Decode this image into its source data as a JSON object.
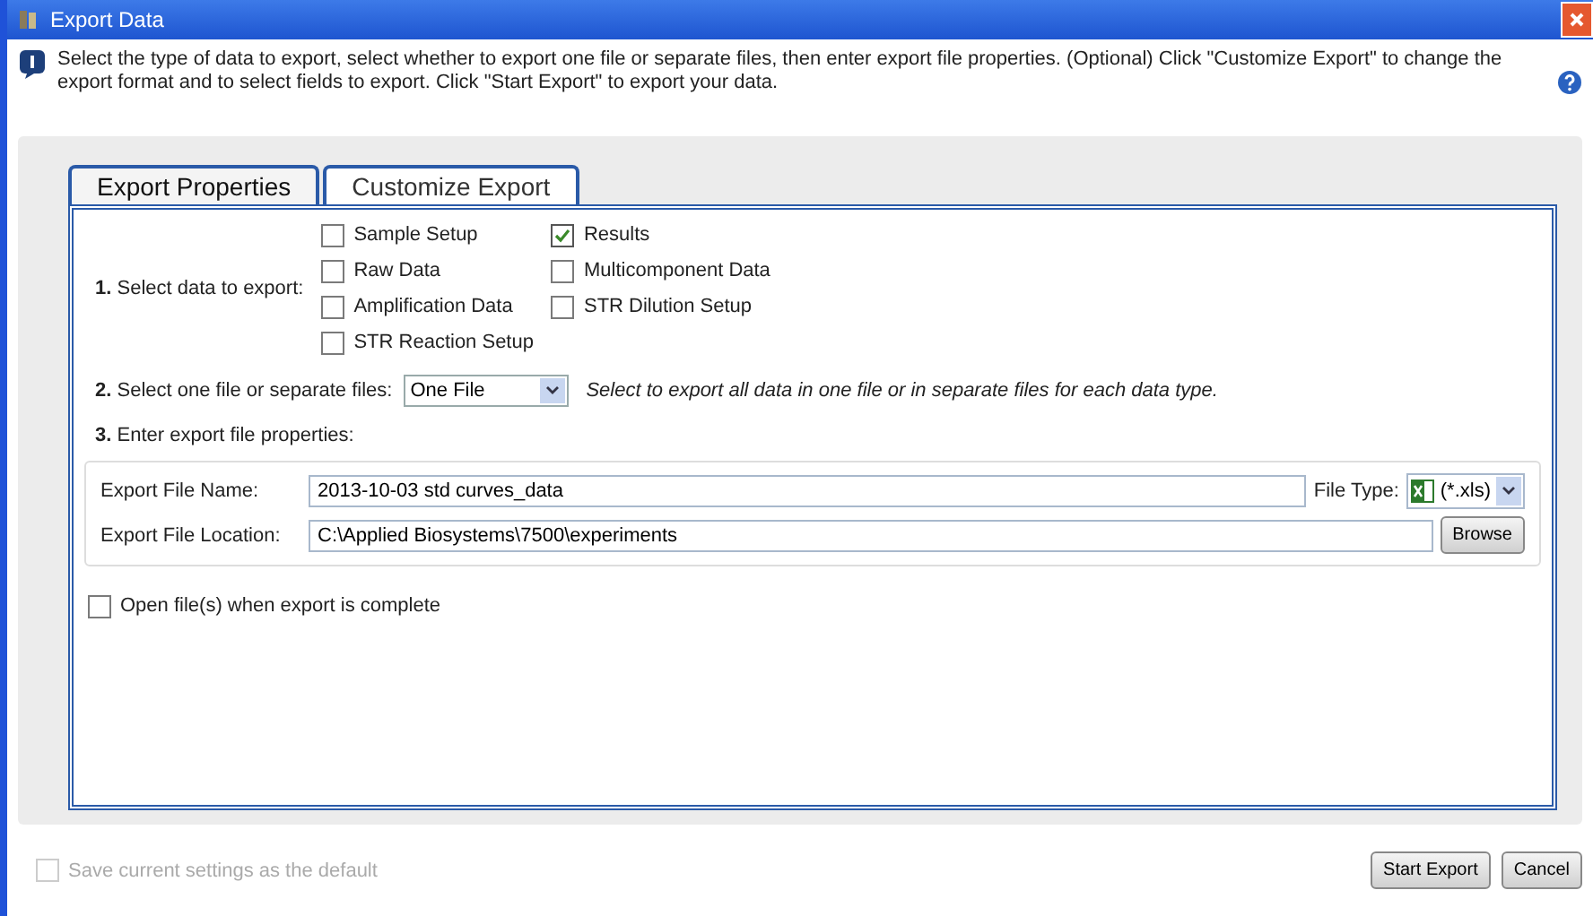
{
  "window": {
    "title": "Export Data"
  },
  "instructions": "Select the type of data to export, select whether to export one file or separate files, then enter export file properties. (Optional) Click \"Customize Export\" to change the export format and to select fields to export. Click \"Start Export\" to export your data.",
  "tabs": [
    {
      "label": "Export Properties",
      "selected": true
    },
    {
      "label": "Customize Export",
      "selected": false
    }
  ],
  "step1": {
    "label": "**1.** Select data to export:",
    "columns": [
      [
        {
          "label": "Sample Setup",
          "checked": false
        },
        {
          "label": "Raw Data",
          "checked": false
        },
        {
          "label": "Amplification Data",
          "checked": false
        },
        {
          "label": "STR Reaction Setup",
          "checked": false
        }
      ],
      [
        {
          "label": "Results",
          "checked": true
        },
        {
          "label": "Multicomponent Data",
          "checked": false
        },
        {
          "label": "STR Dilution Setup",
          "checked": false
        }
      ]
    ]
  },
  "step2": {
    "label": "**2.** Select one file or separate files:",
    "value": "One File",
    "hint": "Select to export all data in one file or in separate files for each data type."
  },
  "step3": {
    "label": "**3.** Enter export file properties:",
    "file_name_label": "Export File Name:",
    "file_name": "2013-10-03 std curves_data",
    "file_type_label": "File Type:",
    "file_type": "(*.xls)",
    "location_label": "Export File Location:",
    "location": "C:\\Applied Biosystems\\7500\\experiments",
    "browse": "Browse"
  },
  "open_when_complete": {
    "label": "Open file(s) when export is complete",
    "checked": false
  },
  "save_default": {
    "label": "Save current settings as the default",
    "checked": false,
    "disabled": true
  },
  "buttons": [
    "Start Export",
    "Cancel"
  ]
}
